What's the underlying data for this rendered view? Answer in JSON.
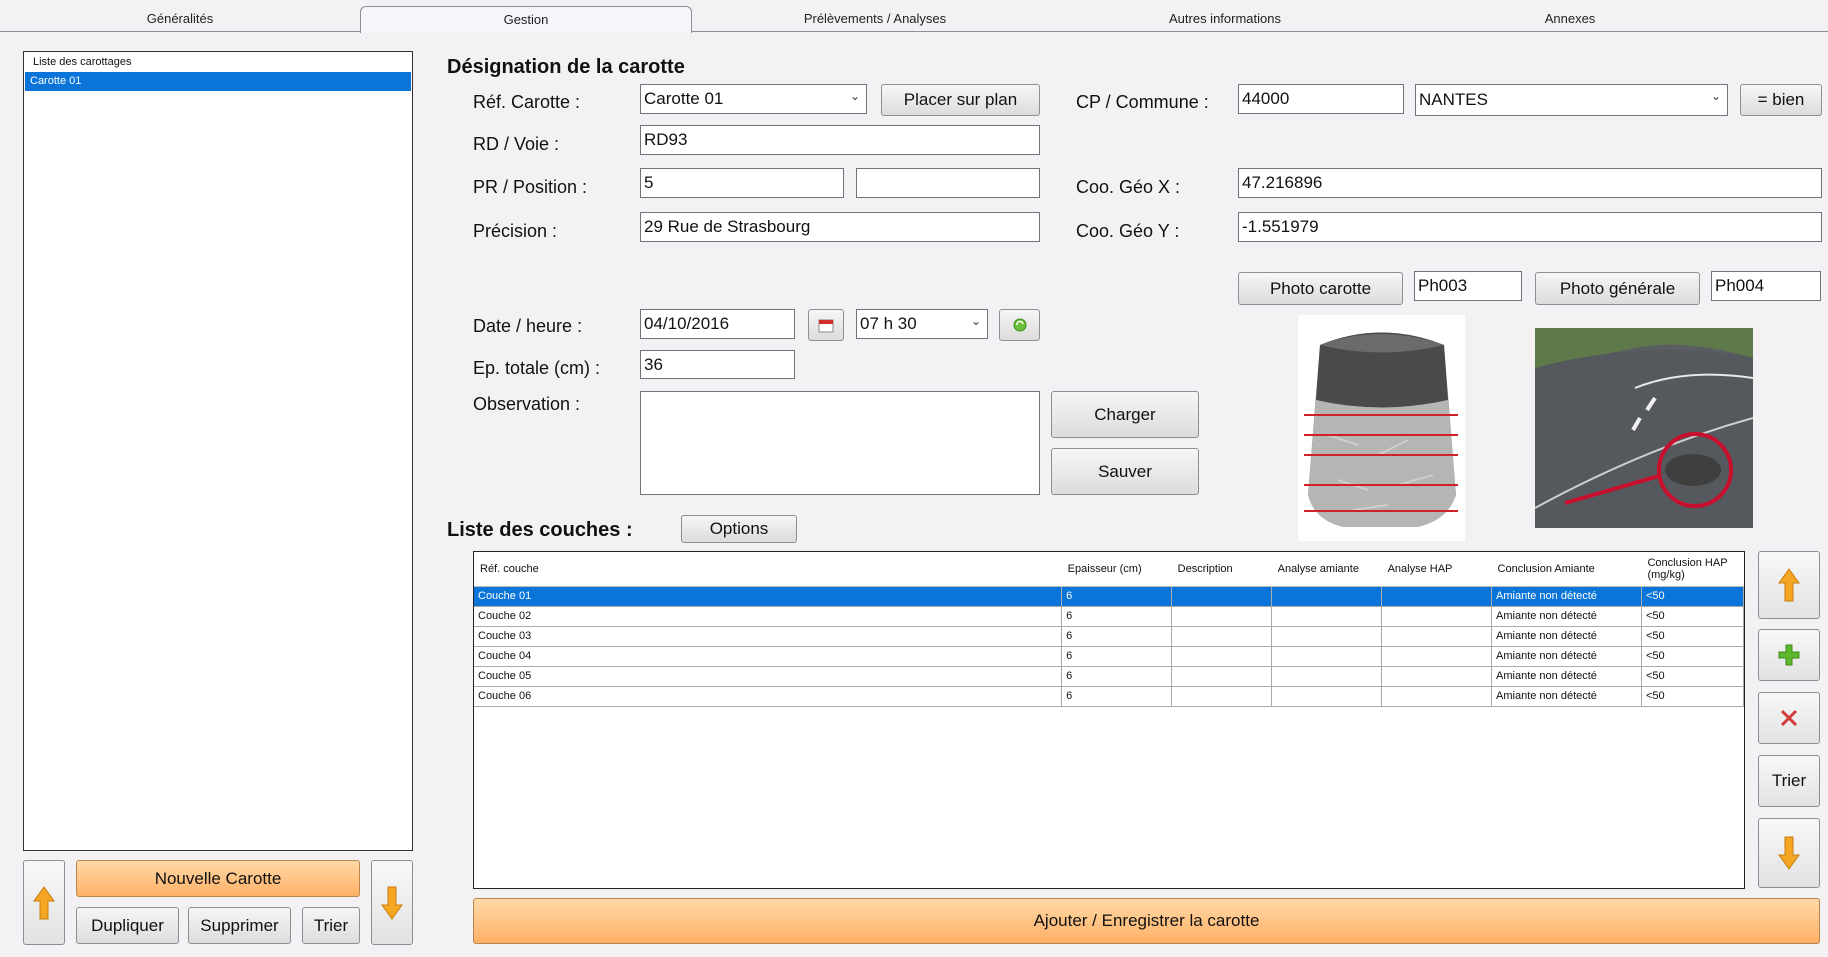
{
  "tabs": [
    "Généralités",
    "Gestion",
    "Prélèvements / Analyses",
    "Autres informations",
    "Annexes"
  ],
  "left": {
    "list_header": "Liste des carottages",
    "items": [
      "Carotte 01"
    ],
    "btn_new": "Nouvelle Carotte",
    "btn_duplicate": "Dupliquer",
    "btn_delete": "Supprimer",
    "btn_sort": "Trier"
  },
  "designation": {
    "title": "Désignation de la carotte",
    "ref_label": "Réf. Carotte :",
    "ref_value": "Carotte 01",
    "btn_place": "Placer sur plan",
    "rd_label": "RD / Voie :",
    "rd_value": "RD93",
    "pr_label": "PR / Position :",
    "pr_value": "5",
    "pr_value2": "",
    "precision_label": "Précision :",
    "precision_value": "29 Rue de Strasbourg",
    "cp_label": "CP / Commune :",
    "cp_value": "44000",
    "commune_value": "NANTES",
    "btn_bien": "= bien",
    "geox_label": "Coo. Géo X :",
    "geox_value": "47.216896",
    "geoy_label": "Coo. Géo Y :",
    "geoy_value": "-1.551979",
    "btn_photo_carotte": "Photo carotte",
    "photo_carotte_ref": "Ph003",
    "btn_photo_generale": "Photo générale",
    "photo_generale_ref": "Ph004",
    "date_label": "Date / heure :",
    "date_value": "04/10/2016",
    "time_value": "07 h 30",
    "ep_label": "Ep. totale (cm) :",
    "ep_value": "36",
    "obs_label": "Observation :",
    "obs_value": "",
    "btn_load": "Charger",
    "btn_save": "Sauver"
  },
  "layers": {
    "title": "Liste des couches :",
    "btn_options": "Options",
    "columns": [
      "Réf. couche",
      "Epaisseur (cm)",
      "Description",
      "Analyse amiante",
      "Analyse HAP",
      "Conclusion Amiante",
      "Conclusion HAP (mg/kg)"
    ],
    "rows": [
      [
        "Couche 01",
        "6",
        "",
        "",
        "",
        "Amiante non détecté",
        "<50"
      ],
      [
        "Couche 02",
        "6",
        "",
        "",
        "",
        "Amiante non détecté",
        "<50"
      ],
      [
        "Couche 03",
        "6",
        "",
        "",
        "",
        "Amiante non détecté",
        "<50"
      ],
      [
        "Couche 04",
        "6",
        "",
        "",
        "",
        "Amiante non détecté",
        "<50"
      ],
      [
        "Couche 05",
        "6",
        "",
        "",
        "",
        "Amiante non détecté",
        "<50"
      ],
      [
        "Couche 06",
        "6",
        "",
        "",
        "",
        "Amiante non détecté",
        "<50"
      ]
    ],
    "btn_sort": "Trier"
  },
  "btn_add_save": "Ajouter / Enregistrer la carotte",
  "colors": {
    "selection": "#0a74d8",
    "orange_top": "#ffd9a8",
    "orange_bottom": "#ffb065",
    "arrow": "#f5a623",
    "plus": "#5cb82a",
    "cross": "#d23a3a"
  }
}
